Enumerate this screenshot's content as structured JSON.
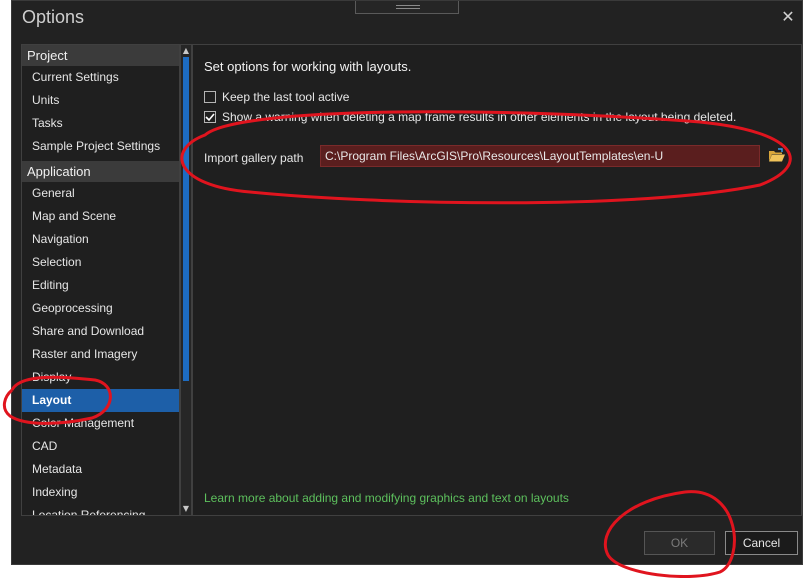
{
  "window": {
    "title": "Options",
    "close_glyph": "✕"
  },
  "nav": {
    "groups": [
      {
        "label": "Project",
        "items": [
          "Current Settings",
          "Units",
          "Tasks",
          "Sample Project Settings"
        ]
      },
      {
        "label": "Application",
        "items": [
          "General",
          "Map and Scene",
          "Navigation",
          "Selection",
          "Editing",
          "Geoprocessing",
          "Share and Download",
          "Raster and Imagery",
          "Display",
          "Layout",
          "Color Management",
          "CAD",
          "Metadata",
          "Indexing",
          "Location Referencing"
        ]
      }
    ],
    "selected": "Layout"
  },
  "content": {
    "heading": "Set options for working with layouts.",
    "options": [
      {
        "label": "Keep the last tool active",
        "checked": false
      },
      {
        "label": "Show a warning when deleting a map frame results in other elements in the layout being deleted.",
        "checked": true
      }
    ],
    "gallery": {
      "label": "Import gallery path",
      "value": "C:\\Program Files\\ArcGIS\\Pro\\Resources\\LayoutTemplates\\en-U"
    },
    "learn_more": "Learn more about adding and modifying graphics and text on layouts"
  },
  "buttons": {
    "ok": "OK",
    "cancel": "Cancel"
  },
  "colors": {
    "accent": "#1d5fa8",
    "annotation": "#e0141e",
    "link": "#5dc05d"
  },
  "icons": {
    "folder": "folder-open-icon",
    "checkmark": "checkmark-icon"
  }
}
